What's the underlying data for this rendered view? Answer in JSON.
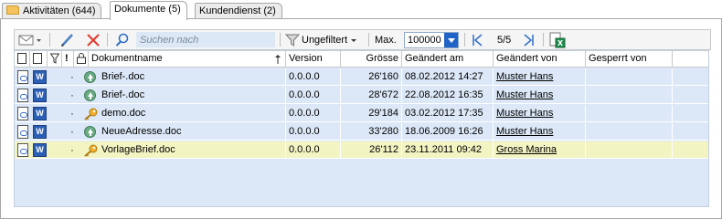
{
  "tabs": [
    {
      "label": "Aktivitäten (644)"
    },
    {
      "label": "Dokumente (5)"
    },
    {
      "label": "Kundendienst (2)"
    }
  ],
  "toolbar": {
    "search_placeholder": "Suchen nach",
    "filter_label": "Ungefiltert",
    "max_label": "Max.",
    "max_value": "100000",
    "page_label": "5/5"
  },
  "columns": {
    "name": "Dokumentname",
    "version": "Version",
    "size": "Grösse",
    "changed_at": "Geändert am",
    "changed_by": "Geändert von",
    "locked_by": "Gesperrt von"
  },
  "rows": [
    {
      "status": "up-arrow",
      "name": "Brief-.doc",
      "version": "0.0.0.0",
      "size": "26'160",
      "changed_at": "08.02.2012 14:27",
      "changed_by": "Muster Hans",
      "locked_by": ""
    },
    {
      "status": "up-arrow",
      "name": "Brief-.doc",
      "version": "0.0.0.0",
      "size": "28'672",
      "changed_at": "22.08.2012 16:35",
      "changed_by": "Muster Hans",
      "locked_by": ""
    },
    {
      "status": "key",
      "name": "demo.doc",
      "version": "0.0.0.0",
      "size": "29'184",
      "changed_at": "03.02.2012 17:35",
      "changed_by": "Muster Hans",
      "locked_by": ""
    },
    {
      "status": "up-arrow",
      "name": "NeueAdresse.doc",
      "version": "0.0.0.0",
      "size": "33'280",
      "changed_at": "18.06.2009 16:26",
      "changed_by": "Muster Hans",
      "locked_by": ""
    },
    {
      "status": "key",
      "name": "VorlageBrief.doc",
      "version": "0.0.0.0",
      "size": "26'112",
      "changed_at": "23.11.2011 09:42",
      "changed_by": "Gross Marina",
      "locked_by": ""
    }
  ],
  "colors": {
    "grid_bg": "#dce8f7",
    "selected_row": "#f2f4c2",
    "accent": "#1e63c5"
  }
}
